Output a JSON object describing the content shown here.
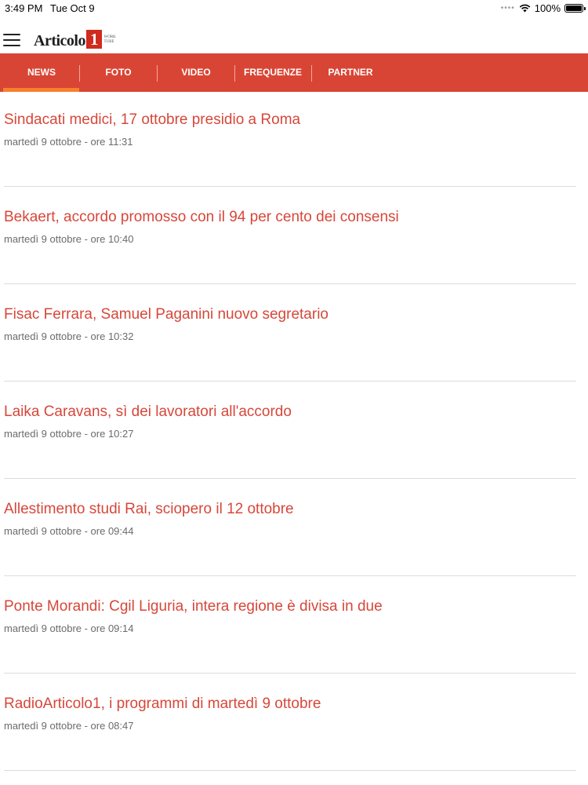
{
  "status": {
    "time": "3:49 PM",
    "date": "Tue Oct 9",
    "battery": "100%",
    "battery_level": 1.0
  },
  "header": {
    "logo_word": "Articolo",
    "logo_number": "1",
    "logo_sub_1": "WORK",
    "logo_sub_2": "TUBE"
  },
  "tabs": [
    "NEWS",
    "FOTO",
    "VIDEO",
    "FREQUENZE",
    "PARTNER"
  ],
  "active_tab": "NEWS",
  "news": [
    {
      "title": "Sindacati medici, 17 ottobre presidio a Roma",
      "date": "martedì 9 ottobre - ore 11:31"
    },
    {
      "title": "Bekaert, accordo promosso con il 94 per cento dei consensi",
      "date": "martedì 9 ottobre - ore 10:40"
    },
    {
      "title": "Fisac Ferrara, Samuel Paganini nuovo segretario",
      "date": "martedì 9 ottobre - ore 10:32"
    },
    {
      "title": "Laika Caravans, sì dei lavoratori all'accordo",
      "date": "martedì 9 ottobre - ore 10:27"
    },
    {
      "title": "Allestimento studi Rai, sciopero il 12 ottobre",
      "date": "martedì 9 ottobre - ore 09:44"
    },
    {
      "title": "Ponte Morandi: Cgil Liguria, intera regione è divisa in due",
      "date": "martedì 9 ottobre - ore 09:14"
    },
    {
      "title": "RadioArticolo1, i programmi di martedì 9 ottobre",
      "date": "martedì 9 ottobre - ore 08:47"
    }
  ],
  "colors": {
    "accent": "#d94535",
    "title": "#d7473a",
    "indicator": "#f7802f",
    "logo_badge": "#cf2b1f"
  }
}
